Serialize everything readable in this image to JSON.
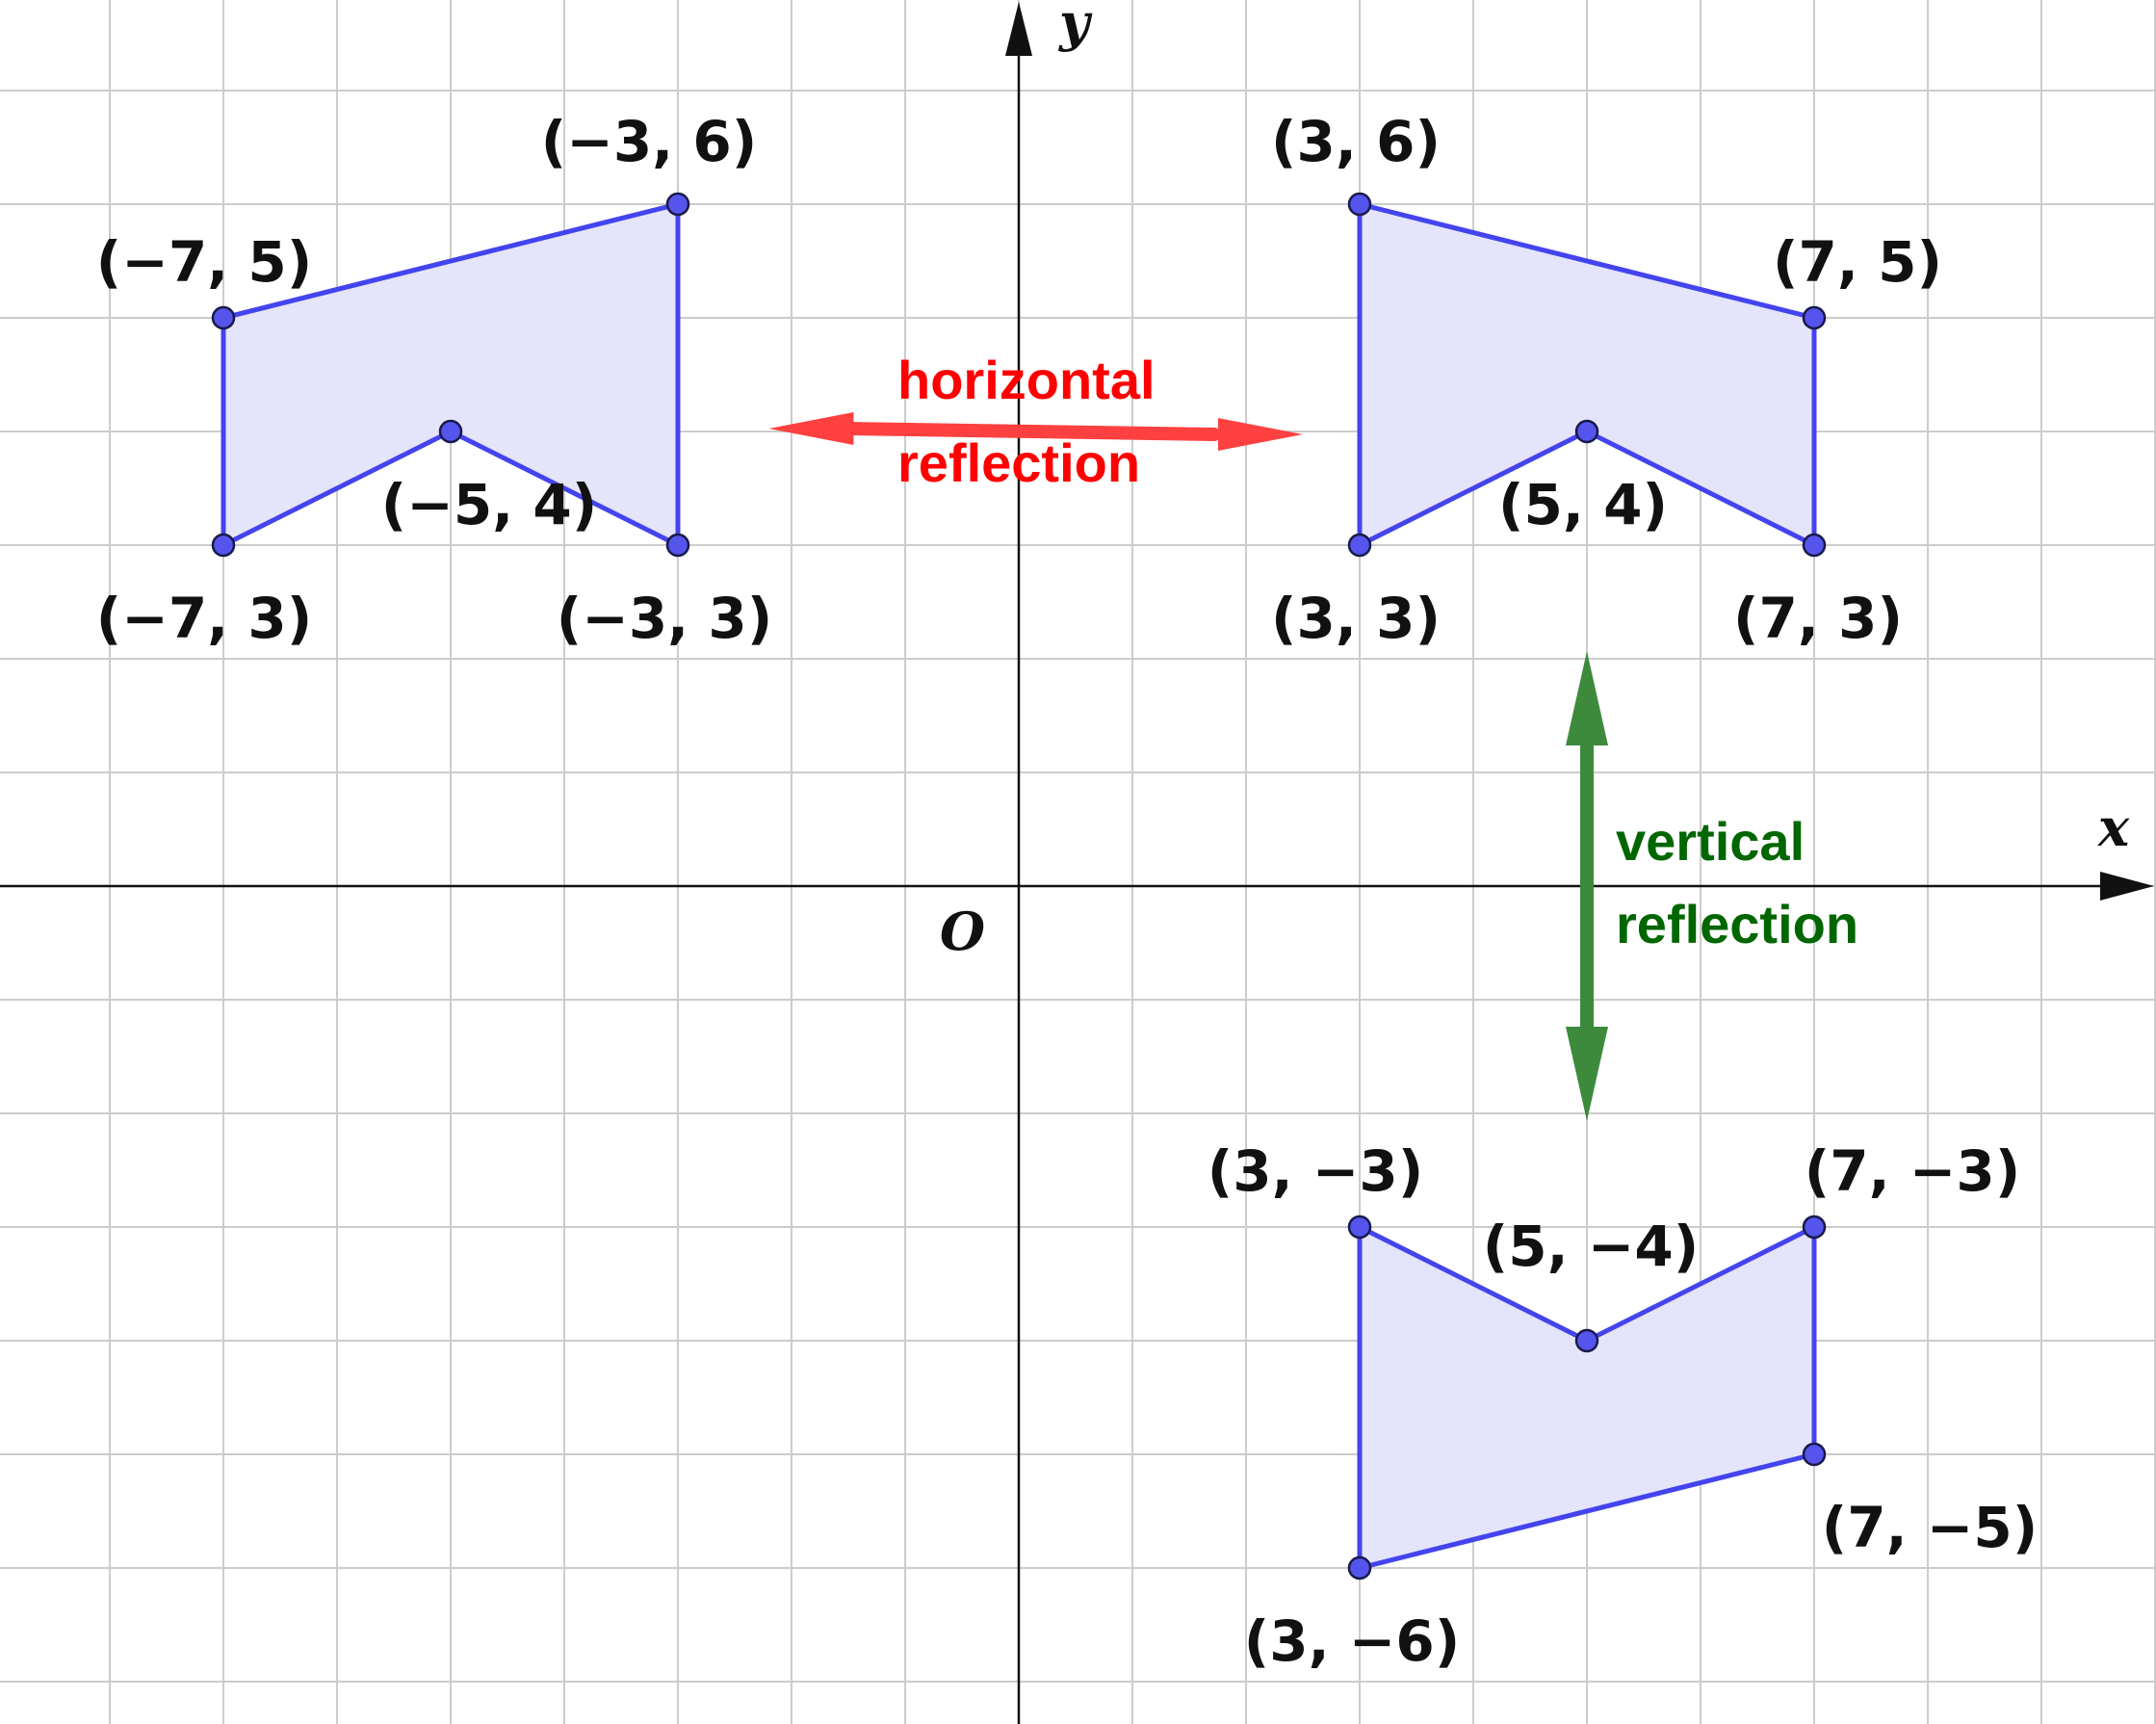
{
  "axes": {
    "x_label": "x",
    "y_label": "y",
    "origin_label": "O"
  },
  "grid": {
    "shown": true,
    "step": 1,
    "x_range": [
      -9,
      10
    ],
    "y_range": [
      -7.5,
      7.5
    ]
  },
  "colors": {
    "shape_stroke": "#4444ee",
    "shape_fill": "#e4e4fb",
    "point_fill": "#5555ee",
    "grid": "#cccccc",
    "axis": "#111111",
    "horizontal_arrow": "#ff4040",
    "vertical_arrow": "#3d8a3d",
    "horizontal_text": "#ff0000",
    "vertical_text": "#006600"
  },
  "shapes": [
    {
      "name": "original",
      "vertices": [
        {
          "x": 3,
          "y": 6,
          "label": "(3, 6)"
        },
        {
          "x": 7,
          "y": 5,
          "label": "(7, 5)"
        },
        {
          "x": 7,
          "y": 3,
          "label": "(7, 3)"
        },
        {
          "x": 5,
          "y": 4,
          "label": "(5, 4)"
        },
        {
          "x": 3,
          "y": 3,
          "label": "(3, 3)"
        }
      ]
    },
    {
      "name": "horizontal-image",
      "vertices": [
        {
          "x": -3,
          "y": 6,
          "label": "(−3, 6)"
        },
        {
          "x": -7,
          "y": 5,
          "label": "(−7, 5)"
        },
        {
          "x": -7,
          "y": 3,
          "label": "(−7, 3)"
        },
        {
          "x": -5,
          "y": 4,
          "label": "(−5, 4)"
        },
        {
          "x": -3,
          "y": 3,
          "label": "(−3, 3)"
        }
      ]
    },
    {
      "name": "vertical-image",
      "vertices": [
        {
          "x": 3,
          "y": -3,
          "label": "(3, −3)"
        },
        {
          "x": 5,
          "y": -4,
          "label": "(5, −4)"
        },
        {
          "x": 7,
          "y": -3,
          "label": "(7, −3)"
        },
        {
          "x": 7,
          "y": -5,
          "label": "(7, −5)"
        },
        {
          "x": 3,
          "y": -6,
          "label": "(3, −6)"
        }
      ]
    }
  ],
  "arrows": {
    "horizontal": {
      "from": {
        "x": -2.2,
        "y": 4
      },
      "to": {
        "x": 2.5,
        "y": 4
      },
      "text": [
        "horizontal",
        "reflection"
      ]
    },
    "vertical": {
      "from": {
        "x": 5,
        "y": 2
      },
      "to": {
        "x": 5,
        "y": -2
      },
      "text": [
        "vertical",
        "reflection"
      ]
    }
  }
}
